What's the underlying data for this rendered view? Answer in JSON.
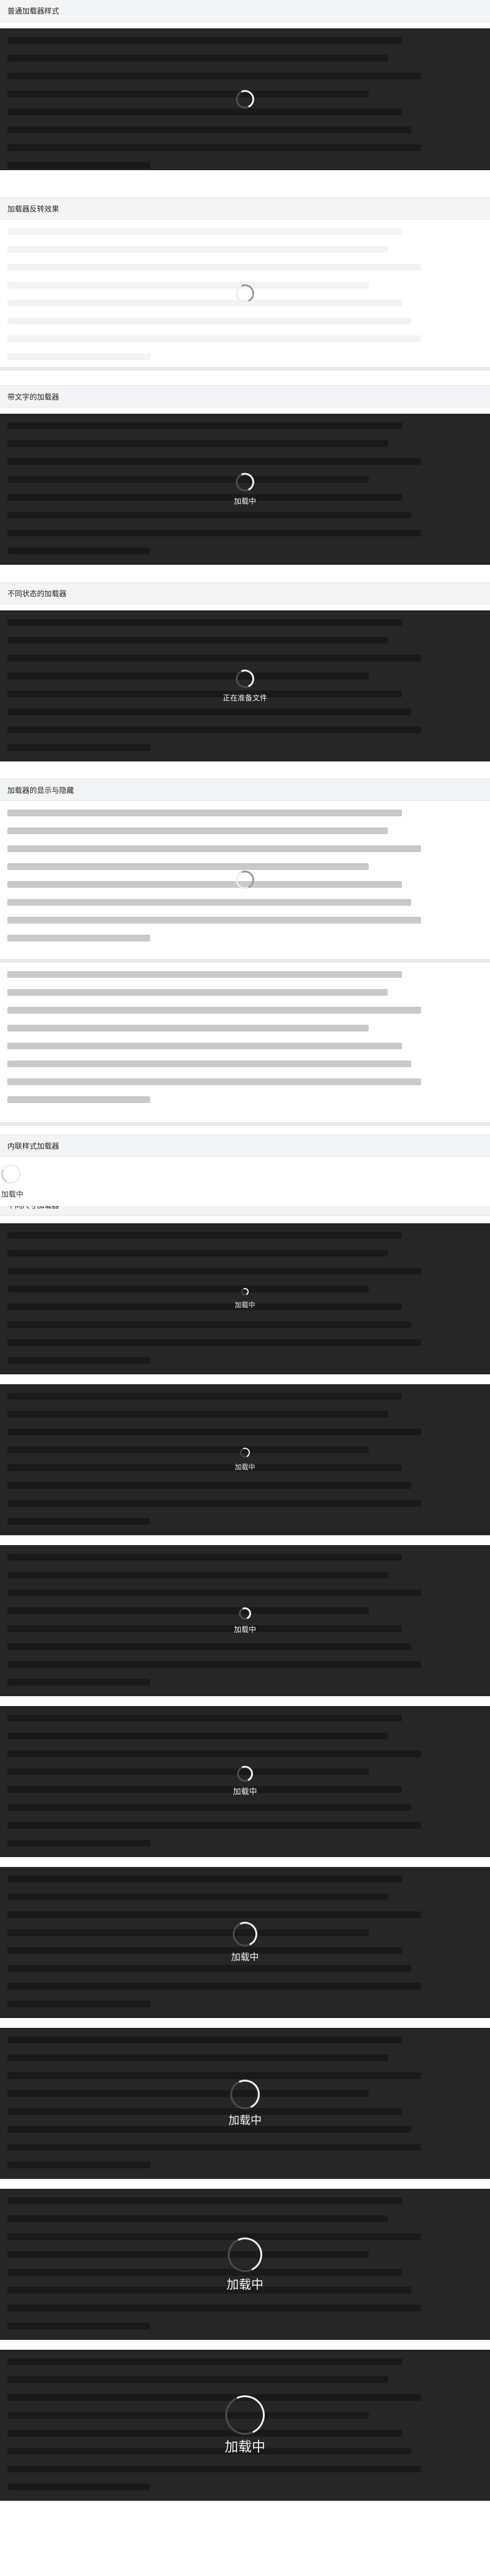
{
  "sections": {
    "basic": {
      "title": "普通加载器样式"
    },
    "inverse": {
      "title": "加载器反转效果"
    },
    "with_text": {
      "title": "带文字的加载器",
      "text": "加载中"
    },
    "states": {
      "title": "不同状态的加载器",
      "text": "正在准备文件"
    },
    "visibility": {
      "title": "加载器的显示与隐藏"
    },
    "inline": {
      "title": "内联样式加载器",
      "text": "加载中"
    },
    "sizes": {
      "title": "不同尺寸加载器",
      "text": "加载中"
    }
  },
  "colors": {
    "dark_background": "#262626",
    "light_background": "#ffffff",
    "section_header_background": "#f3f4f6",
    "loader_light": "#f0f0f0"
  },
  "icons": [
    "loader-spinner-icon"
  ]
}
